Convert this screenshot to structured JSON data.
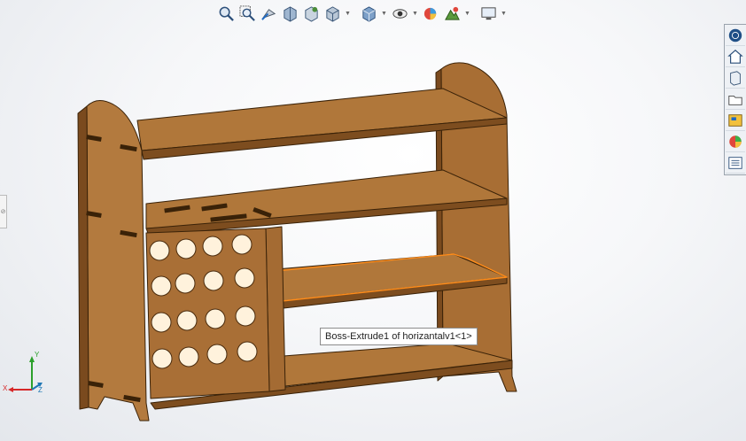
{
  "toolbar": {
    "icons": [
      "zoom-to-fit-icon",
      "zoom-to-area-icon",
      "previous-view-icon",
      "section-view-icon",
      "dynamic-annotation-icon",
      "view-orientation-icon",
      "display-style-icon",
      "hide-show-items-icon",
      "edit-appearance-icon",
      "apply-scene-icon",
      "view-settings-icon"
    ]
  },
  "task_pane": {
    "icons": [
      "solidworks-resources-icon",
      "design-library-icon",
      "file-explorer-icon",
      "view-palette-icon",
      "appearances-icon",
      "custom-properties-icon"
    ]
  },
  "viewport": {
    "tooltip": "Boss-Extrude1 of horizantalv1<1>",
    "triad": {
      "x_label": "X",
      "y_label": "Y",
      "z_label": "Z"
    }
  },
  "colors": {
    "wood_light": "#b0773a",
    "wood_mid": "#9a6530",
    "wood_dark": "#6f4418",
    "edge": "#3a2208",
    "highlight": "#ff8c1a"
  }
}
